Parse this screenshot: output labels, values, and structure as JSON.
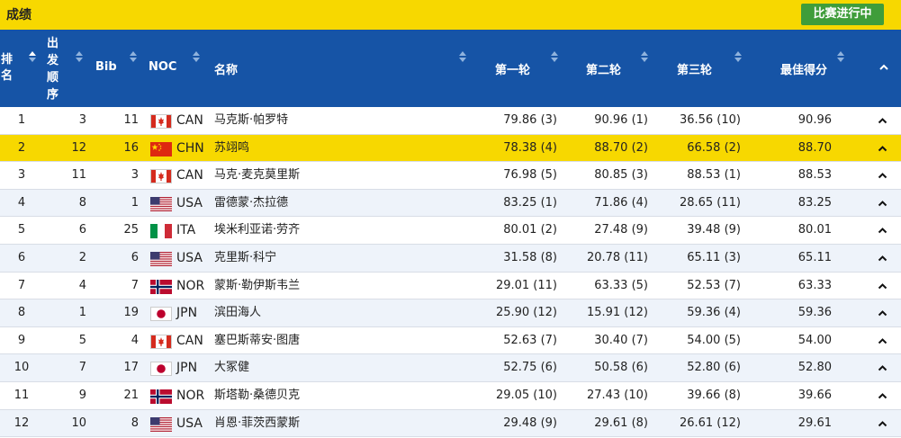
{
  "header": {
    "title": "成绩",
    "status_label": "比赛进行中"
  },
  "columns": {
    "rank": "排名",
    "order": "出发顺序",
    "bib": "Bib",
    "noc": "NOC",
    "name": "名称",
    "round1": "第一轮",
    "round2": "第二轮",
    "round3": "第三轮",
    "best": "最佳得分"
  },
  "icons": {
    "sort": "sort-arrows-icon",
    "toggle": "chevron-up-icon",
    "flags": {
      "CAN": "canada-flag-icon",
      "CHN": "china-flag-icon",
      "USA": "usa-flag-icon",
      "ITA": "italy-flag-icon",
      "NOR": "norway-flag-icon",
      "JPN": "japan-flag-icon"
    }
  },
  "colors": {
    "header_bar": "#f7d800",
    "table_header": "#1654a6",
    "status_button": "#3f9d3a",
    "highlight_row": "#f7d800"
  },
  "rows": [
    {
      "rank": "1",
      "order": "3",
      "bib": "11",
      "noc": "CAN",
      "name": "马克斯·帕罗特",
      "r1": "79.86 (3)",
      "r2": "90.96 (1)",
      "r3": "36.56 (10)",
      "best": "90.96"
    },
    {
      "rank": "2",
      "order": "12",
      "bib": "16",
      "noc": "CHN",
      "name": "苏翊鸣",
      "r1": "78.38 (4)",
      "r2": "88.70 (2)",
      "r3": "66.58 (2)",
      "best": "88.70"
    },
    {
      "rank": "3",
      "order": "11",
      "bib": "3",
      "noc": "CAN",
      "name": "马克·麦克莫里斯",
      "r1": "76.98 (5)",
      "r2": "80.85 (3)",
      "r3": "88.53 (1)",
      "best": "88.53"
    },
    {
      "rank": "4",
      "order": "8",
      "bib": "1",
      "noc": "USA",
      "name": "雷德蒙·杰拉德",
      "r1": "83.25 (1)",
      "r2": "71.86 (4)",
      "r3": "28.65 (11)",
      "best": "83.25"
    },
    {
      "rank": "5",
      "order": "6",
      "bib": "25",
      "noc": "ITA",
      "name": "埃米利亚诺·劳齐",
      "r1": "80.01 (2)",
      "r2": "27.48 (9)",
      "r3": "39.48 (9)",
      "best": "80.01"
    },
    {
      "rank": "6",
      "order": "2",
      "bib": "6",
      "noc": "USA",
      "name": "克里斯·科宁",
      "r1": "31.58 (8)",
      "r2": "20.78 (11)",
      "r3": "65.11 (3)",
      "best": "65.11"
    },
    {
      "rank": "7",
      "order": "4",
      "bib": "7",
      "noc": "NOR",
      "name": "蒙斯·勒伊斯韦兰",
      "r1": "29.01 (11)",
      "r2": "63.33 (5)",
      "r3": "52.53 (7)",
      "best": "63.33"
    },
    {
      "rank": "8",
      "order": "1",
      "bib": "19",
      "noc": "JPN",
      "name": "滨田海人",
      "r1": "25.90 (12)",
      "r2": "15.91 (12)",
      "r3": "59.36 (4)",
      "best": "59.36"
    },
    {
      "rank": "9",
      "order": "5",
      "bib": "4",
      "noc": "CAN",
      "name": "塞巴斯蒂安·图唐",
      "r1": "52.63 (7)",
      "r2": "30.40 (7)",
      "r3": "54.00 (5)",
      "best": "54.00"
    },
    {
      "rank": "10",
      "order": "7",
      "bib": "17",
      "noc": "JPN",
      "name": "大冢健",
      "r1": "52.75 (6)",
      "r2": "50.58 (6)",
      "r3": "52.80 (6)",
      "best": "52.80"
    },
    {
      "rank": "11",
      "order": "9",
      "bib": "21",
      "noc": "NOR",
      "name": "斯塔勒·桑德贝克",
      "r1": "29.05 (10)",
      "r2": "27.43 (10)",
      "r3": "39.66 (8)",
      "best": "39.66"
    },
    {
      "rank": "12",
      "order": "10",
      "bib": "8",
      "noc": "USA",
      "name": "肖恩·菲茨西蒙斯",
      "r1": "29.48 (9)",
      "r2": "29.61 (8)",
      "r3": "26.61 (12)",
      "best": "29.61"
    }
  ]
}
